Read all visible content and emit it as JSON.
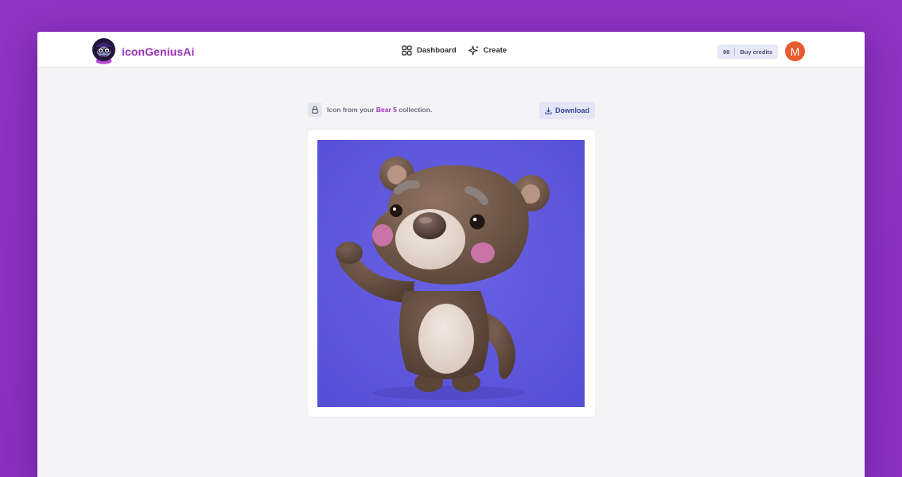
{
  "brand": {
    "name": "iconGeniusAi",
    "logo_icon": "cartoon-mascot-icon"
  },
  "nav": [
    {
      "label": "Dashboard",
      "icon": "dashboard-icon"
    },
    {
      "label": "Create",
      "icon": "sparkle-icon"
    }
  ],
  "credits": {
    "count": "98",
    "buy_label": "Buy credits"
  },
  "user": {
    "initial": "M",
    "avatar_color": "#e65a2e"
  },
  "info": {
    "prefix": "Icon from your ",
    "collection": "Bear 5",
    "suffix": " collection.",
    "lock_icon": "lock-icon"
  },
  "download": {
    "label": "Download",
    "icon": "download-icon"
  },
  "image": {
    "description": "3D brown teddy bear waving",
    "background_color": "#5b56d9"
  },
  "colors": {
    "brand": "#9b32b8",
    "page_bg": "#8e33c4",
    "accent": "#3d4396"
  }
}
